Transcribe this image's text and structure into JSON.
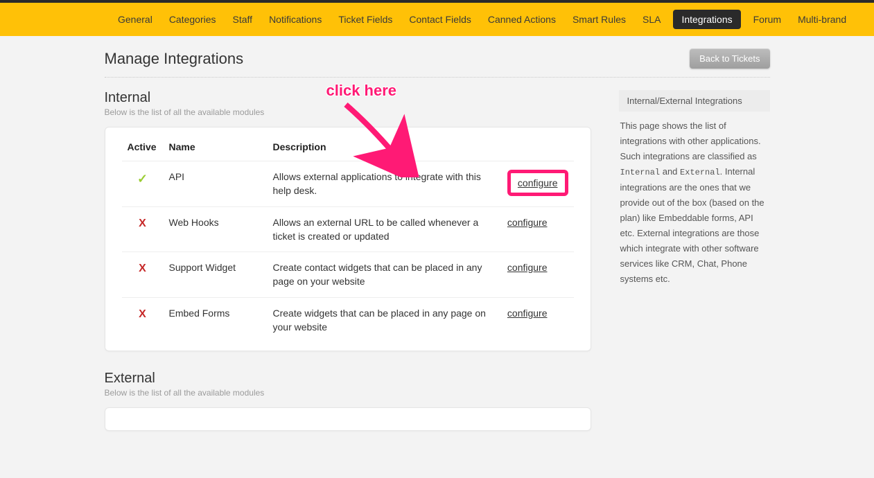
{
  "nav": {
    "items": [
      "General",
      "Categories",
      "Staff",
      "Notifications",
      "Ticket Fields",
      "Contact Fields",
      "Canned Actions",
      "Smart Rules",
      "SLA",
      "Integrations",
      "Forum",
      "Multi-brand"
    ],
    "active_index": 9
  },
  "header": {
    "title": "Manage Integrations",
    "back_label": "Back to Tickets"
  },
  "annotation": {
    "text": "click here"
  },
  "internal": {
    "title": "Internal",
    "subtitle": "Below is the list of all the available modules",
    "columns": {
      "active": "Active",
      "name": "Name",
      "description": "Description"
    },
    "rows": [
      {
        "active": true,
        "name": "API",
        "description": "Allows external applications to integrate with this help desk.",
        "action": "configure",
        "highlight": true
      },
      {
        "active": false,
        "name": "Web Hooks",
        "description": "Allows an external URL to be called whenever a ticket is created or updated",
        "action": "configure",
        "highlight": false
      },
      {
        "active": false,
        "name": "Support Widget",
        "description": "Create contact widgets that can be placed in any page on your website",
        "action": "configure",
        "highlight": false
      },
      {
        "active": false,
        "name": "Embed Forms",
        "description": "Create widgets that can be placed in any page on your website",
        "action": "configure",
        "highlight": false
      }
    ]
  },
  "external": {
    "title": "External",
    "subtitle": "Below is the list of all the available modules"
  },
  "sidebar": {
    "title": "Internal/External Integrations",
    "p1": "This page shows the list of integrations with other applications. Such integrations are classified as ",
    "mono1": "Internal",
    "and": " and ",
    "mono2": "External",
    "p2": ". Internal integrations are the ones that we provide out of the box (based on the plan) like Embeddable forms, API etc. External integrations are those which integrate with other software services like CRM, Chat, Phone systems etc."
  }
}
